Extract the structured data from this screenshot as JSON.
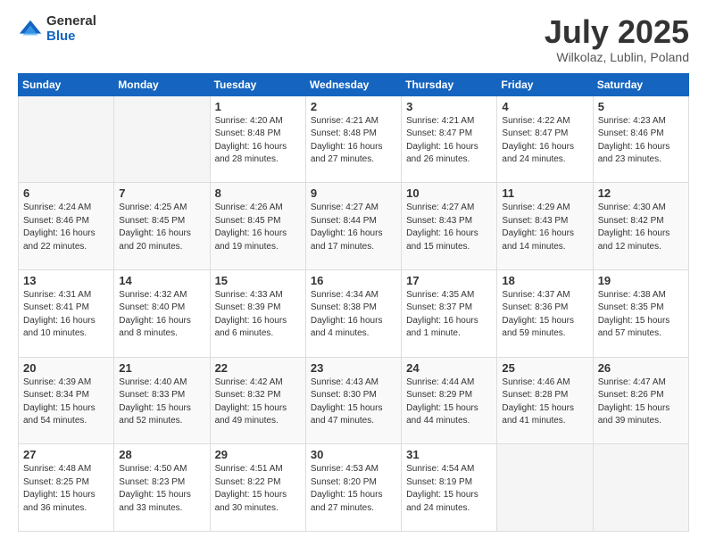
{
  "logo": {
    "general": "General",
    "blue": "Blue"
  },
  "title": "July 2025",
  "location": "Wilkolaz, Lublin, Poland",
  "weekdays": [
    "Sunday",
    "Monday",
    "Tuesday",
    "Wednesday",
    "Thursday",
    "Friday",
    "Saturday"
  ],
  "weeks": [
    [
      {
        "day": "",
        "sunrise": "",
        "sunset": "",
        "daylight": ""
      },
      {
        "day": "",
        "sunrise": "",
        "sunset": "",
        "daylight": ""
      },
      {
        "day": "1",
        "sunrise": "Sunrise: 4:20 AM",
        "sunset": "Sunset: 8:48 PM",
        "daylight": "Daylight: 16 hours and 28 minutes."
      },
      {
        "day": "2",
        "sunrise": "Sunrise: 4:21 AM",
        "sunset": "Sunset: 8:48 PM",
        "daylight": "Daylight: 16 hours and 27 minutes."
      },
      {
        "day": "3",
        "sunrise": "Sunrise: 4:21 AM",
        "sunset": "Sunset: 8:47 PM",
        "daylight": "Daylight: 16 hours and 26 minutes."
      },
      {
        "day": "4",
        "sunrise": "Sunrise: 4:22 AM",
        "sunset": "Sunset: 8:47 PM",
        "daylight": "Daylight: 16 hours and 24 minutes."
      },
      {
        "day": "5",
        "sunrise": "Sunrise: 4:23 AM",
        "sunset": "Sunset: 8:46 PM",
        "daylight": "Daylight: 16 hours and 23 minutes."
      }
    ],
    [
      {
        "day": "6",
        "sunrise": "Sunrise: 4:24 AM",
        "sunset": "Sunset: 8:46 PM",
        "daylight": "Daylight: 16 hours and 22 minutes."
      },
      {
        "day": "7",
        "sunrise": "Sunrise: 4:25 AM",
        "sunset": "Sunset: 8:45 PM",
        "daylight": "Daylight: 16 hours and 20 minutes."
      },
      {
        "day": "8",
        "sunrise": "Sunrise: 4:26 AM",
        "sunset": "Sunset: 8:45 PM",
        "daylight": "Daylight: 16 hours and 19 minutes."
      },
      {
        "day": "9",
        "sunrise": "Sunrise: 4:27 AM",
        "sunset": "Sunset: 8:44 PM",
        "daylight": "Daylight: 16 hours and 17 minutes."
      },
      {
        "day": "10",
        "sunrise": "Sunrise: 4:27 AM",
        "sunset": "Sunset: 8:43 PM",
        "daylight": "Daylight: 16 hours and 15 minutes."
      },
      {
        "day": "11",
        "sunrise": "Sunrise: 4:29 AM",
        "sunset": "Sunset: 8:43 PM",
        "daylight": "Daylight: 16 hours and 14 minutes."
      },
      {
        "day": "12",
        "sunrise": "Sunrise: 4:30 AM",
        "sunset": "Sunset: 8:42 PM",
        "daylight": "Daylight: 16 hours and 12 minutes."
      }
    ],
    [
      {
        "day": "13",
        "sunrise": "Sunrise: 4:31 AM",
        "sunset": "Sunset: 8:41 PM",
        "daylight": "Daylight: 16 hours and 10 minutes."
      },
      {
        "day": "14",
        "sunrise": "Sunrise: 4:32 AM",
        "sunset": "Sunset: 8:40 PM",
        "daylight": "Daylight: 16 hours and 8 minutes."
      },
      {
        "day": "15",
        "sunrise": "Sunrise: 4:33 AM",
        "sunset": "Sunset: 8:39 PM",
        "daylight": "Daylight: 16 hours and 6 minutes."
      },
      {
        "day": "16",
        "sunrise": "Sunrise: 4:34 AM",
        "sunset": "Sunset: 8:38 PM",
        "daylight": "Daylight: 16 hours and 4 minutes."
      },
      {
        "day": "17",
        "sunrise": "Sunrise: 4:35 AM",
        "sunset": "Sunset: 8:37 PM",
        "daylight": "Daylight: 16 hours and 1 minute."
      },
      {
        "day": "18",
        "sunrise": "Sunrise: 4:37 AM",
        "sunset": "Sunset: 8:36 PM",
        "daylight": "Daylight: 15 hours and 59 minutes."
      },
      {
        "day": "19",
        "sunrise": "Sunrise: 4:38 AM",
        "sunset": "Sunset: 8:35 PM",
        "daylight": "Daylight: 15 hours and 57 minutes."
      }
    ],
    [
      {
        "day": "20",
        "sunrise": "Sunrise: 4:39 AM",
        "sunset": "Sunset: 8:34 PM",
        "daylight": "Daylight: 15 hours and 54 minutes."
      },
      {
        "day": "21",
        "sunrise": "Sunrise: 4:40 AM",
        "sunset": "Sunset: 8:33 PM",
        "daylight": "Daylight: 15 hours and 52 minutes."
      },
      {
        "day": "22",
        "sunrise": "Sunrise: 4:42 AM",
        "sunset": "Sunset: 8:32 PM",
        "daylight": "Daylight: 15 hours and 49 minutes."
      },
      {
        "day": "23",
        "sunrise": "Sunrise: 4:43 AM",
        "sunset": "Sunset: 8:30 PM",
        "daylight": "Daylight: 15 hours and 47 minutes."
      },
      {
        "day": "24",
        "sunrise": "Sunrise: 4:44 AM",
        "sunset": "Sunset: 8:29 PM",
        "daylight": "Daylight: 15 hours and 44 minutes."
      },
      {
        "day": "25",
        "sunrise": "Sunrise: 4:46 AM",
        "sunset": "Sunset: 8:28 PM",
        "daylight": "Daylight: 15 hours and 41 minutes."
      },
      {
        "day": "26",
        "sunrise": "Sunrise: 4:47 AM",
        "sunset": "Sunset: 8:26 PM",
        "daylight": "Daylight: 15 hours and 39 minutes."
      }
    ],
    [
      {
        "day": "27",
        "sunrise": "Sunrise: 4:48 AM",
        "sunset": "Sunset: 8:25 PM",
        "daylight": "Daylight: 15 hours and 36 minutes."
      },
      {
        "day": "28",
        "sunrise": "Sunrise: 4:50 AM",
        "sunset": "Sunset: 8:23 PM",
        "daylight": "Daylight: 15 hours and 33 minutes."
      },
      {
        "day": "29",
        "sunrise": "Sunrise: 4:51 AM",
        "sunset": "Sunset: 8:22 PM",
        "daylight": "Daylight: 15 hours and 30 minutes."
      },
      {
        "day": "30",
        "sunrise": "Sunrise: 4:53 AM",
        "sunset": "Sunset: 8:20 PM",
        "daylight": "Daylight: 15 hours and 27 minutes."
      },
      {
        "day": "31",
        "sunrise": "Sunrise: 4:54 AM",
        "sunset": "Sunset: 8:19 PM",
        "daylight": "Daylight: 15 hours and 24 minutes."
      },
      {
        "day": "",
        "sunrise": "",
        "sunset": "",
        "daylight": ""
      },
      {
        "day": "",
        "sunrise": "",
        "sunset": "",
        "daylight": ""
      }
    ]
  ]
}
